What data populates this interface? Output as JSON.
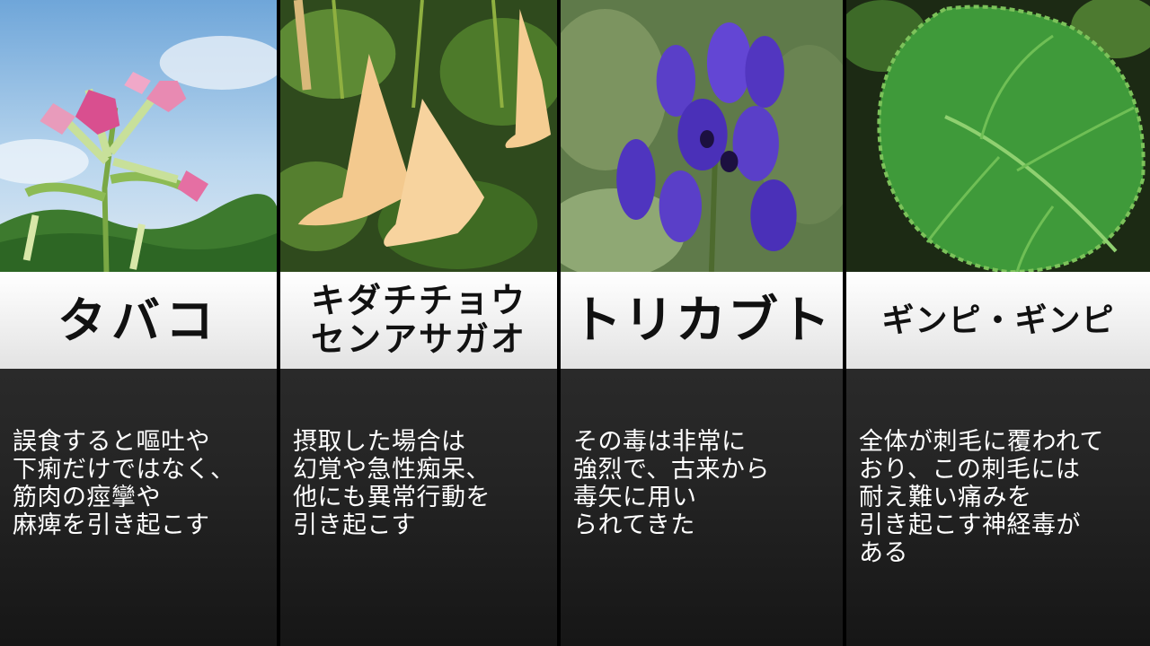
{
  "cards": [
    {
      "title": "タバコ",
      "description": "誤食すると嘔吐や\n下痢だけではなく、\n筋肉の痙攣や\n麻痺を引き起こす",
      "image": "pink-tobacco-flowers-blue-sky"
    },
    {
      "title": "キダチチョウ\nセンアサガオ",
      "description": "摂取した場合は\n幻覚や急性痴呆、\n他にも異常行動を\n引き起こす",
      "image": "yellow-trumpet-flowers"
    },
    {
      "title": "トリカブト",
      "description": "その毒は非常に\n強烈で、古来から\n毒矢に用い\nられてきた",
      "image": "purple-aconite-flowers"
    },
    {
      "title": "ギンピ・ギンピ",
      "description": "全体が刺毛に覆われて\nおり、この刺毛には\n耐え難い痛みを\n引き起こす神経毒が\nある",
      "image": "serrated-green-leaf"
    }
  ],
  "colors": {
    "title_bg": "#f2f2f2",
    "desc_bg": "#222222",
    "desc_text": "#ffffff"
  }
}
